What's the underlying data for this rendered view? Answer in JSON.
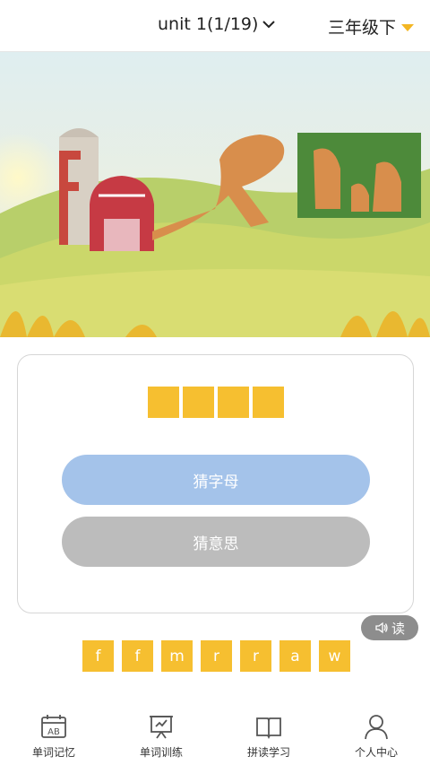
{
  "header": {
    "unit_label": "unit 1(1/19)",
    "grade_label": "三年级下",
    "accent_color": "#f3b623"
  },
  "illustration": {
    "description_icon": "farm-scene-image"
  },
  "card": {
    "blank_count": 4,
    "guess_letter_label": "猜字母",
    "guess_meaning_label": "猜意思"
  },
  "read_button": {
    "label": "读",
    "icon": "speaker-icon"
  },
  "letter_tiles": [
    "f",
    "f",
    "m",
    "r",
    "r",
    "a",
    "w"
  ],
  "bottom_nav": {
    "items": [
      {
        "label": "单词记忆",
        "icon": "ab-calendar-icon"
      },
      {
        "label": "单词训练",
        "icon": "presentation-icon"
      },
      {
        "label": "拼读学习",
        "icon": "book-icon"
      },
      {
        "label": "个人中心",
        "icon": "person-icon"
      }
    ]
  }
}
